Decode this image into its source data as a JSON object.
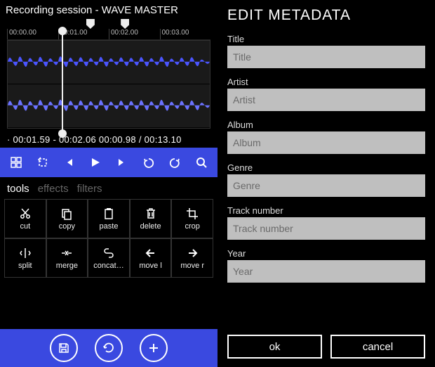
{
  "left": {
    "session_title": "Recording session - WAVE MASTER",
    "ruler": [
      "00:00.00",
      "00:01.00",
      "00:02.00",
      "00:03.00"
    ],
    "time_readout": "· 00:01.59 - 00:02.06    00:00.98 / 00:13.10",
    "tabs": {
      "tools": "tools",
      "effects": "effects",
      "filters": "filters"
    },
    "tools": {
      "cut": "cut",
      "copy": "copy",
      "paste": "paste",
      "delete": "delete",
      "crop": "crop",
      "split": "split",
      "merge": "merge",
      "concat": "concat…",
      "movel": "move l",
      "mover": "move r"
    }
  },
  "right": {
    "heading": "EDIT METADATA",
    "fields": {
      "title": {
        "label": "Title",
        "placeholder": "Title"
      },
      "artist": {
        "label": "Artist",
        "placeholder": "Artist"
      },
      "album": {
        "label": "Album",
        "placeholder": "Album"
      },
      "genre": {
        "label": "Genre",
        "placeholder": "Genre"
      },
      "track": {
        "label": "Track number",
        "placeholder": "Track number"
      },
      "year": {
        "label": "Year",
        "placeholder": "Year"
      }
    },
    "buttons": {
      "ok": "ok",
      "cancel": "cancel"
    }
  },
  "colors": {
    "accent": "#3a49e0",
    "wave": "#5b63ff"
  }
}
